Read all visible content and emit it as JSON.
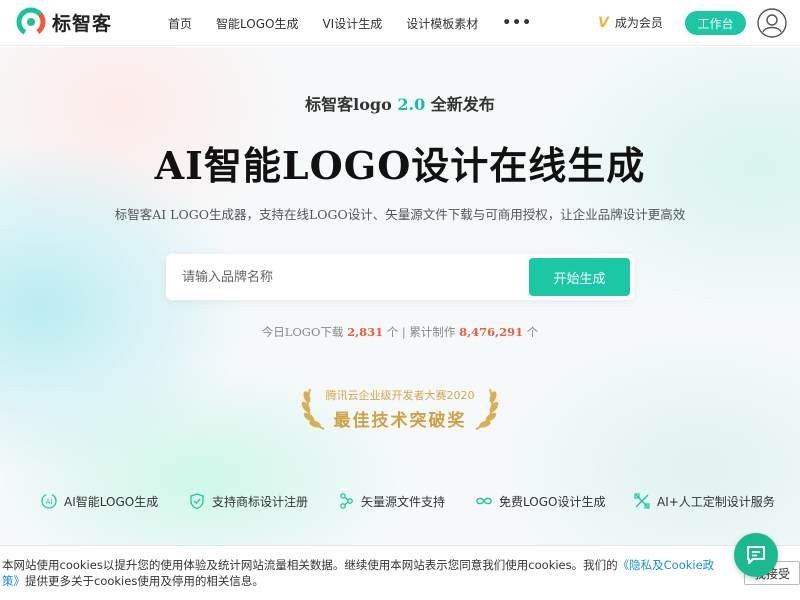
{
  "header": {
    "brand": "标智客",
    "nav": [
      "首页",
      "智能LOGO生成",
      "VI设计生成",
      "设计模板素材"
    ],
    "more": "•••",
    "member_icon": "V",
    "member_label": "成为会员",
    "workbench_label": "工作台",
    "avatar_icon": "user-avatar-icon"
  },
  "hero": {
    "subhead_prefix": "标智客logo",
    "subhead_version": "2.0",
    "subhead_suffix": "全新发布",
    "title": "AI智能LOGO设计在线生成",
    "description": "标智客AI LOGO生成器，支持在线LOGO设计、矢量源文件下载与可商用授权，让企业品牌设计更高效",
    "search_placeholder": "请输入品牌名称",
    "search_value": "",
    "generate_label": "开始生成",
    "stats": {
      "today_label": "今日LOGO下载",
      "today_value": "2,831",
      "today_unit": "个",
      "separator": "|",
      "total_label": "累计制作",
      "total_value": "8,476,291",
      "total_unit": "个"
    },
    "award": {
      "top": "腾讯云企业级开发者大赛2020",
      "main": "最佳技术突破奖"
    },
    "features": [
      {
        "label": "AI智能LOGO生成",
        "icon": "ai-icon"
      },
      {
        "label": "支持商标设计注册",
        "icon": "shield-check-icon"
      },
      {
        "label": "矢量源文件支持",
        "icon": "share-nodes-icon"
      },
      {
        "label": "免费LOGO设计生成",
        "icon": "infinity-icon"
      },
      {
        "label": "AI+人工定制设计服务",
        "icon": "tools-icon"
      }
    ]
  },
  "cookie": {
    "text_before": "本网站使用cookies以提升您的使用体验及统计网站流量相关数据。继续使用本网站表示您同意我们使用cookies。我们的",
    "link": "《隐私及Cookie政策》",
    "text_after": "提供更多关于cookies使用及停用的相关信息。",
    "accept_label": "我接受"
  },
  "colors": {
    "accent": "#1bc7a4",
    "stat_number": "#e8603c",
    "award_gold": "#d0a142",
    "link": "#1a8fd0"
  }
}
